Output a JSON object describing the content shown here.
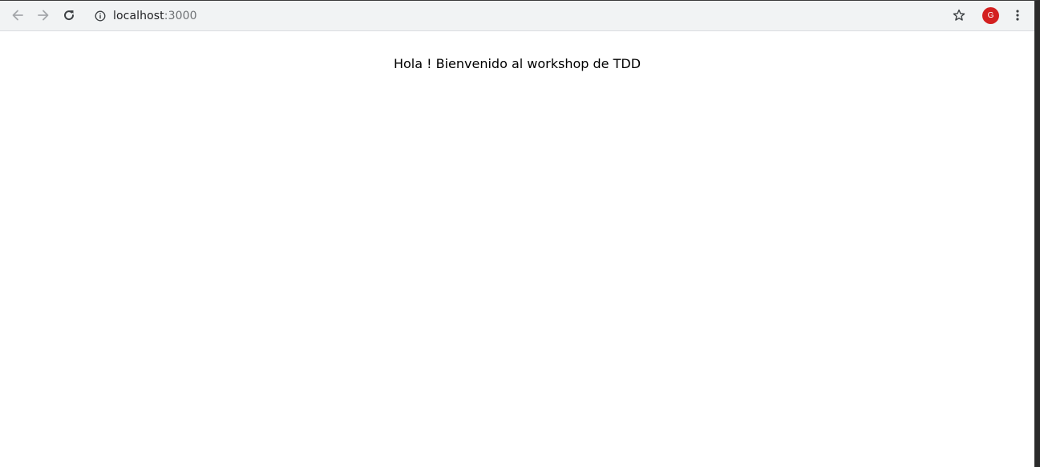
{
  "browser": {
    "url_host": "localhost",
    "url_port": ":3000",
    "profile_initial": "G",
    "icons": {
      "back": "arrow-left-icon",
      "forward": "arrow-right-icon",
      "reload": "reload-icon",
      "site_info": "info-icon",
      "bookmark": "star-icon",
      "menu": "kebab-menu-icon"
    },
    "colors": {
      "toolbar": "#f1f3f4",
      "profile_avatar": "#d32020"
    }
  },
  "page": {
    "greeting": "Hola ! Bienvenido al workshop de TDD"
  }
}
